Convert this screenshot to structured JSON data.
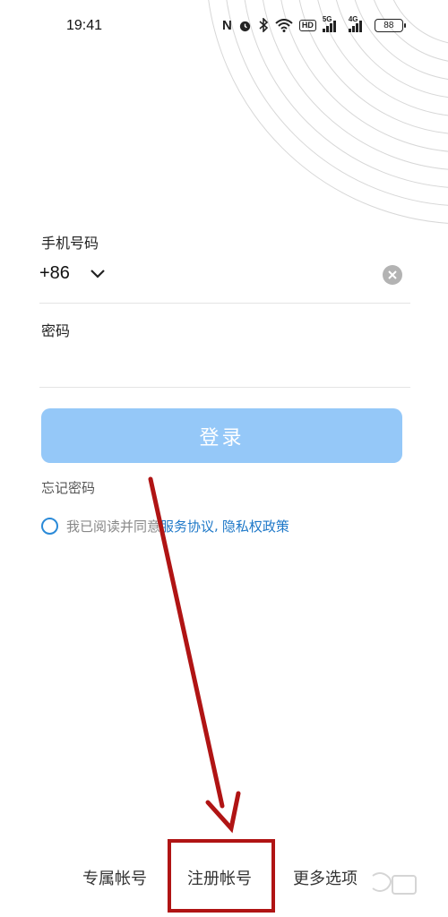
{
  "status_bar": {
    "time": "19:41",
    "icons": [
      "nfc-icon",
      "alarm-icon",
      "bluetooth-icon",
      "wifi-icon",
      "hd-icon",
      "signal-5g-icon",
      "signal-4g-icon",
      "battery-icon"
    ],
    "hd_label": "HD",
    "sim1_network": "5G",
    "sim2_network": "4G",
    "battery_level": "88"
  },
  "login": {
    "phone_label": "手机号码",
    "country_code": "+86",
    "password_label": "密码",
    "login_button": "登录",
    "forgot_password": "忘记密码",
    "agreement_prefix": "我已阅读并同意",
    "service_agreement": "服务协议",
    "separator": ",",
    "privacy_policy": "隐私权政策"
  },
  "bottom_nav": {
    "exclusive_account": "专属帐号",
    "register_account": "注册帐号",
    "more_options": "更多选项"
  },
  "colors": {
    "login_button_bg": "#95c8f8",
    "link": "#1e78c8",
    "radio": "#2a8ad8",
    "annotation": "#b01414"
  }
}
